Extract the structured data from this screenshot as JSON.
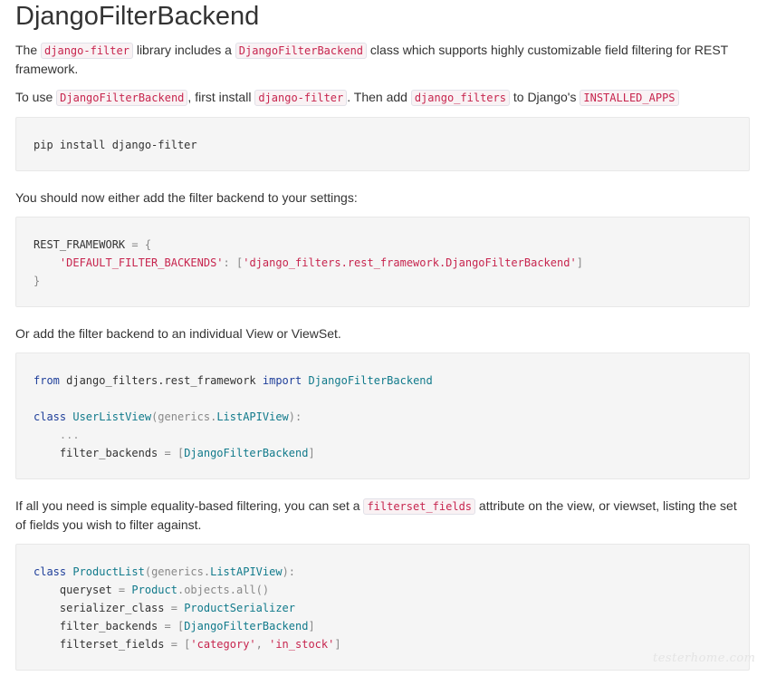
{
  "title": "DjangoFilterBackend",
  "intro": {
    "t1": "The ",
    "c1": "django-filter",
    "t2": " library includes a ",
    "c2": "DjangoFilterBackend",
    "t3": " class which supports highly customizable field filtering for REST framework."
  },
  "install_para": {
    "t1": "To use ",
    "c1": "DjangoFilterBackend",
    "t2": ", first install ",
    "c2": "django-filter",
    "t3": ". Then add ",
    "c3": "django_filters",
    "t4": " to Django's ",
    "c4": "INSTALLED_APPS"
  },
  "code_install": "pip install django-filter",
  "settings_para": "You should now either add the filter backend to your settings:",
  "code_settings": {
    "l1a": "REST_FRAMEWORK",
    "l1b": " = {",
    "l2a": "'DEFAULT_FILTER_BACKENDS'",
    "l2b": ": [",
    "l2c": "'django_filters.rest_framework.DjangoFilterBackend'",
    "l2d": "]",
    "l3": "}"
  },
  "view_para": "Or add the filter backend to an individual View or ViewSet.",
  "code_view": {
    "kw_from": "from",
    "mod": " django_filters.rest_framework ",
    "kw_import": "import",
    "imp_cls": "DjangoFilterBackend",
    "kw_class": "class",
    "cls_name": "UserListView",
    "base_a": "(generics.",
    "base_b": "ListAPIView",
    "base_c": "):",
    "ellipsis": "...",
    "attr": "filter_backends",
    "eq": " = [",
    "val": "DjangoFilterBackend",
    "close": "]"
  },
  "fields_para": {
    "t1": "If all you need is simple equality-based filtering, you can set a ",
    "c1": "filterset_fields",
    "t2": " attribute on the view, or viewset, listing the set of fields you wish to filter against."
  },
  "code_product": {
    "kw_class": "class",
    "cls_name": "ProductList",
    "base_a": "(generics.",
    "base_b": "ListAPIView",
    "base_c": "):",
    "qs_attr": "queryset",
    "qs_eq": " = ",
    "qs_model": "Product",
    "qs_rest": ".objects.all()",
    "sc_attr": "serializer_class",
    "sc_eq": " = ",
    "sc_val": "ProductSerializer",
    "fb_attr": "filter_backends",
    "fb_eq": " = [",
    "fb_val": "DjangoFilterBackend",
    "fb_close": "]",
    "ff_attr": "filterset_fields",
    "ff_eq": " = [",
    "ff_v1": "'category'",
    "ff_sep": ", ",
    "ff_v2": "'in_stock'",
    "ff_close": "]"
  },
  "watermark": "testerhome.com"
}
